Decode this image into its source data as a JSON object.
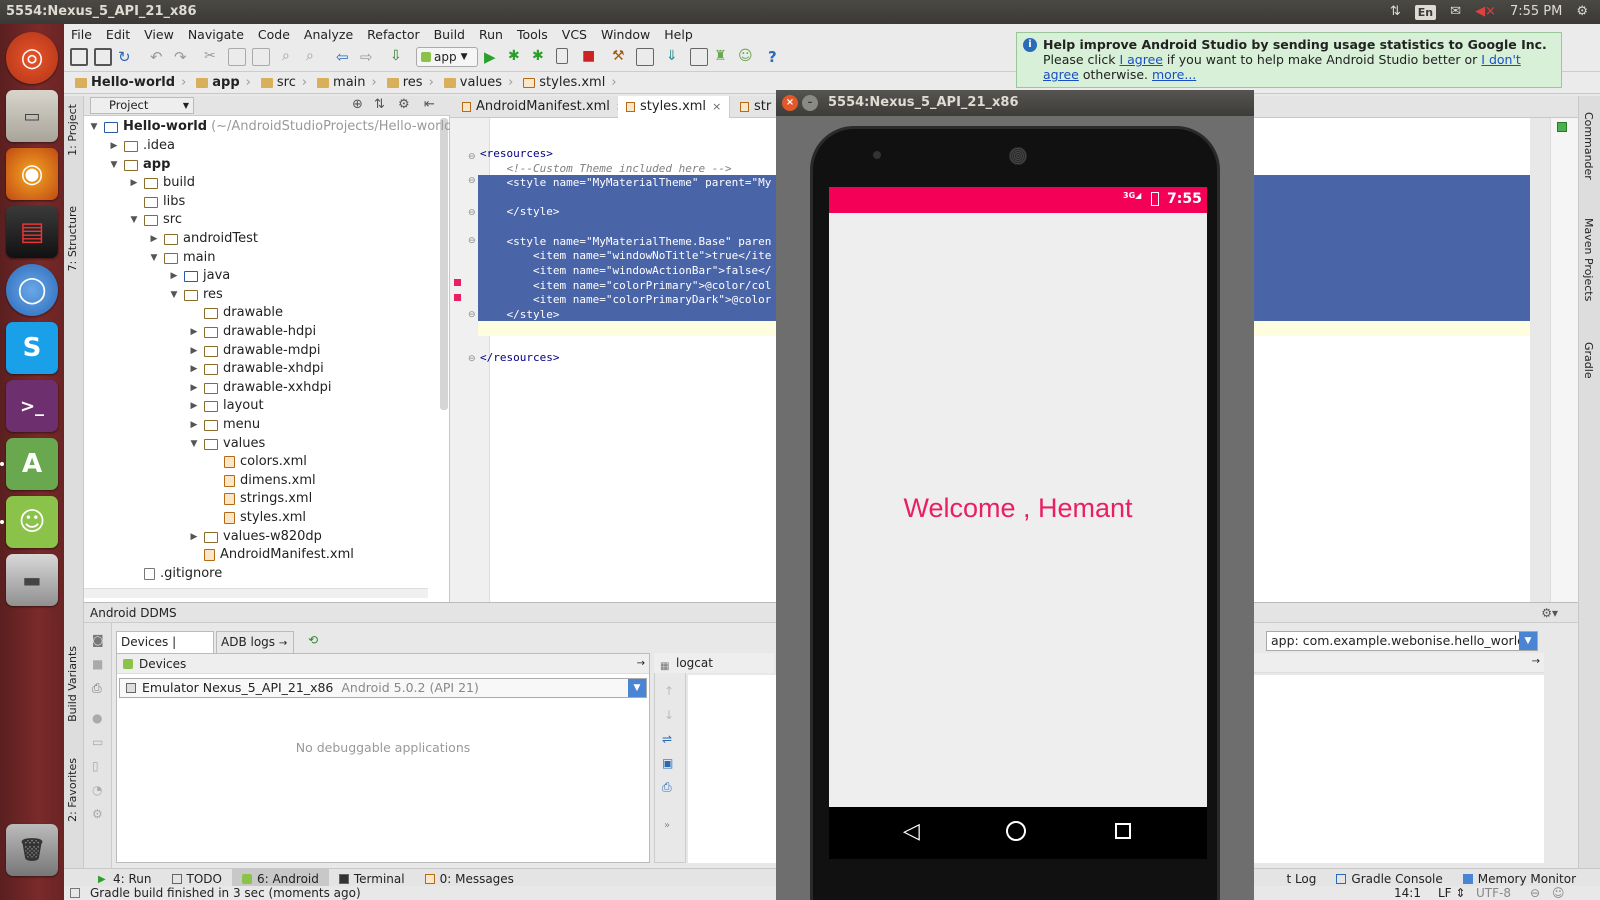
{
  "top_panel": {
    "window_title": "5554:Nexus_5_API_21_x86",
    "keyboard_layout": "En",
    "clock": "7:55 PM"
  },
  "launcher": {
    "icons": [
      "ubuntu-dash-icon",
      "files-icon",
      "firefox-icon",
      "monitor-icon",
      "chromium-icon",
      "skype-icon",
      "terminal-icon",
      "android-studio-icon",
      "android-icon",
      "disk-drive-icon",
      "trash-icon"
    ]
  },
  "menubar": {
    "items": [
      "File",
      "Edit",
      "View",
      "Navigate",
      "Code",
      "Analyze",
      "Refactor",
      "Build",
      "Run",
      "Tools",
      "VCS",
      "Window",
      "Help"
    ]
  },
  "toolbar": {
    "run_config": "app"
  },
  "breadcrumbs": [
    "Hello-world",
    "app",
    "src",
    "main",
    "res",
    "values",
    "styles.xml"
  ],
  "project_panel": {
    "selector": "Project",
    "tree": [
      {
        "label": "Hello-world",
        "suffix": "(~/AndroidStudioProjects/Hello-world",
        "bold": true
      },
      {
        "label": ".idea"
      },
      {
        "label": "app",
        "bold": true
      },
      {
        "label": "build"
      },
      {
        "label": "libs"
      },
      {
        "label": "src"
      },
      {
        "label": "androidTest"
      },
      {
        "label": "main"
      },
      {
        "label": "java"
      },
      {
        "label": "res"
      },
      {
        "label": "drawable"
      },
      {
        "label": "drawable-hdpi"
      },
      {
        "label": "drawable-mdpi"
      },
      {
        "label": "drawable-xhdpi"
      },
      {
        "label": "drawable-xxhdpi"
      },
      {
        "label": "layout"
      },
      {
        "label": "menu"
      },
      {
        "label": "values"
      },
      {
        "label": "colors.xml"
      },
      {
        "label": "dimens.xml"
      },
      {
        "label": "strings.xml"
      },
      {
        "label": "styles.xml"
      },
      {
        "label": "values-w820dp"
      },
      {
        "label": "AndroidManifest.xml"
      },
      {
        "label": ".gitignore"
      }
    ]
  },
  "left_tool_tabs": {
    "project": "1: Project",
    "structure": "7: Structure",
    "build_variants": "Build Variants",
    "favorites": "2: Favorites"
  },
  "right_tool_tabs": {
    "commander": "Commander",
    "maven": "Maven Projects",
    "gradle": "Gradle"
  },
  "editor_tabs": [
    {
      "label": "AndroidManifest.xml",
      "active": false
    },
    {
      "label": "styles.xml",
      "active": true
    },
    {
      "label": "str",
      "active": false
    }
  ],
  "code_lines": [
    "<resources>",
    "    <!--Custom Theme included here -->",
    "    <style name=\"MyMaterialTheme\" parent=\"My",
    "",
    "    </style>",
    "",
    "    <style name=\"MyMaterialTheme.Base\" paren",
    "        <item name=\"windowNoTitle\">true</ite",
    "        <item name=\"windowActionBar\">false</",
    "        <item name=\"colorPrimary\">@color/col",
    "        <item name=\"colorPrimaryDark\">@color",
    "    </style>",
    "",
    "",
    "</resources>"
  ],
  "notification": {
    "title": "Help improve Android Studio by sending usage statistics to Google Inc.",
    "line2_pre": "Please click ",
    "agree_link": "I agree",
    "line2_post": " if you want to help make Android Studio better or ",
    "disagree_link_a": "I don't",
    "disagree_link_b": "agree",
    "line3_post": " otherwise. ",
    "more_link": "more..."
  },
  "ddms": {
    "title": "Android DDMS",
    "tab_devices": "Devices | logcat",
    "tab_adb": "ADB logs",
    "devices_header": "Devices",
    "device_selected": "Emulator Nexus_5_API_21_x86",
    "device_meta": "Android 5.0.2 (API 21)",
    "empty_message": "No debuggable applications",
    "logcat_header": "logcat",
    "app_filter": "app: com.example.webonise.hello_world"
  },
  "tool_windows": [
    {
      "label": "4: Run"
    },
    {
      "label": "TODO"
    },
    {
      "label": "6: Android",
      "active": true
    },
    {
      "label": "Terminal"
    },
    {
      "label": "0: Messages"
    }
  ],
  "tool_windows_right": [
    {
      "label": "t Log"
    },
    {
      "label": "Gradle Console"
    },
    {
      "label": "Memory Monitor"
    }
  ],
  "status_bar": {
    "message": "Gradle build finished in 3 sec (moments ago)",
    "position": "14:1",
    "line_sep": "LF",
    "encoding": "UTF-8"
  },
  "emulator": {
    "title": "5554:Nexus_5_API_21_x86",
    "status_signal": "3G",
    "status_time": "7:55",
    "welcome_text": "Welcome , Hemant",
    "status_color": "#f50057",
    "accent_color": "#e91e63"
  }
}
